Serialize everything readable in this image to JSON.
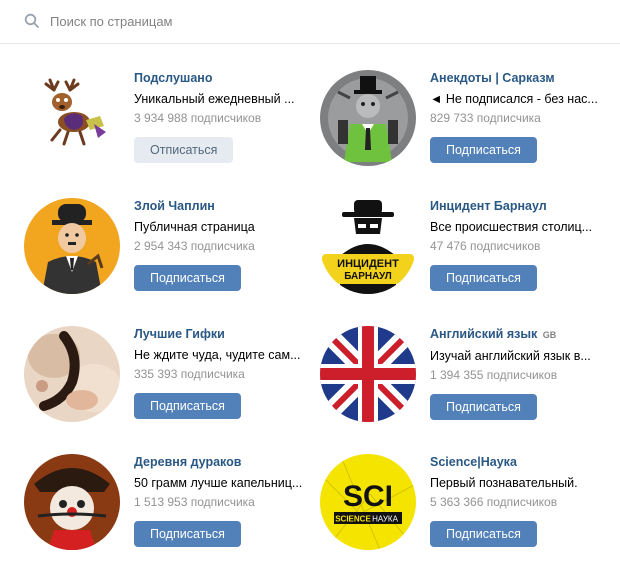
{
  "search": {
    "placeholder": "Поиск по страницам",
    "icon": "search-icon"
  },
  "colors": {
    "link": "#2a5885",
    "button": "#5181b8",
    "button_secondary": "#e5ebf1",
    "muted": "#939393"
  },
  "groups": [
    {
      "name": "Подслушано",
      "tag": "",
      "description": "Уникальный ежедневный ...",
      "subscribers": "3 934 988 подписчиков",
      "button": "Отписаться",
      "subscribed": true,
      "avatar": "deer-icon"
    },
    {
      "name": "Анекдоты | Сарказм",
      "tag": "",
      "description": "◄ Не подписался - без нас...",
      "subscribers": "829 733 подписчика",
      "button": "Подписаться",
      "subscribed": false,
      "avatar": "gentleman-rabbit-icon"
    },
    {
      "name": "Злой Чаплин",
      "tag": "",
      "description": "Публичная страница",
      "subscribers": "2 954 343 подписчика",
      "button": "Подписаться",
      "subscribed": false,
      "avatar": "chaplin-icon"
    },
    {
      "name": "Инцидент Барнаул",
      "tag": "",
      "description": "Все происшествия столиц...",
      "subscribers": "47 476 подписчиков",
      "button": "Подписаться",
      "subscribed": false,
      "avatar": "incident-spy-icon",
      "avatar_text": [
        "ИНЦИДЕНТ",
        "БАРНАУЛ"
      ]
    },
    {
      "name": "Лучшие Гифки",
      "tag": "",
      "description": "Не ждите чуда, чудите сам...",
      "subscribers": "335 393 подписчика",
      "button": "Подписаться",
      "subscribed": false,
      "avatar": "photo-icon"
    },
    {
      "name": "Английский язык",
      "tag": "GB",
      "description": "Изучай английский язык в...",
      "subscribers": "1 394 355 подписчиков",
      "button": "Подписаться",
      "subscribed": false,
      "avatar": "union-jack-icon"
    },
    {
      "name": "Деревня дураков",
      "tag": "",
      "description": "50 грамм лучше капельниц...",
      "subscribers": "1 513 953 подписчика",
      "button": "Подписаться",
      "subscribed": false,
      "avatar": "clown-icon"
    },
    {
      "name": "Science|Наука",
      "tag": "",
      "description": "Первый познавательный.",
      "subscribers": "5 363 366 подписчиков",
      "button": "Подписаться",
      "subscribed": false,
      "avatar": "science-logo-icon",
      "avatar_text": [
        "SCI",
        "SCIENCE",
        "НАУКА"
      ]
    }
  ]
}
